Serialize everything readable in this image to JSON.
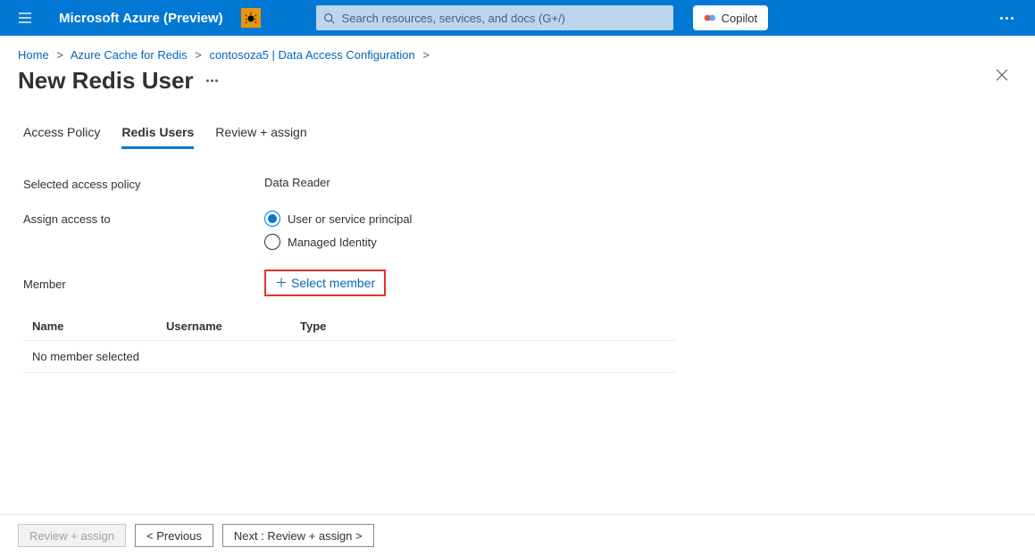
{
  "topbar": {
    "brand": "Microsoft Azure (Preview)",
    "search_placeholder": "Search resources, services, and docs (G+/)",
    "copilot_label": "Copilot"
  },
  "breadcrumb": {
    "items": [
      {
        "label": "Home"
      },
      {
        "label": "Azure Cache for Redis"
      },
      {
        "label": "contosoza5 | Data Access Configuration"
      }
    ]
  },
  "page": {
    "title": "New Redis User"
  },
  "tabs": [
    {
      "label": "Access Policy",
      "active": false
    },
    {
      "label": "Redis Users",
      "active": true
    },
    {
      "label": "Review + assign",
      "active": false
    }
  ],
  "form": {
    "selected_policy_label": "Selected access policy",
    "selected_policy_value": "Data Reader",
    "assign_label": "Assign access to",
    "assign_options": [
      {
        "label": "User or service principal",
        "selected": true
      },
      {
        "label": "Managed Identity",
        "selected": false
      }
    ],
    "member_label": "Member",
    "select_member_label": "Select member"
  },
  "members_table": {
    "headers": {
      "name": "Name",
      "username": "Username",
      "type": "Type"
    },
    "empty_row": "No member selected"
  },
  "footer": {
    "review_btn": "Review + assign",
    "prev_btn": "< Previous",
    "next_btn": "Next : Review + assign >"
  }
}
